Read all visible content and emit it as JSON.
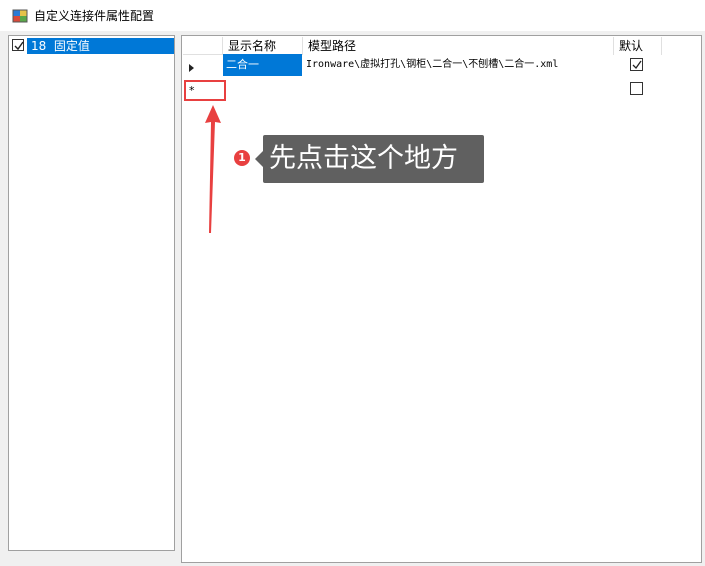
{
  "window": {
    "title": "自定义连接件属性配置"
  },
  "tree": {
    "items": [
      {
        "checked": true,
        "label": "18  固定值"
      }
    ]
  },
  "grid": {
    "columns": [
      {
        "label": "显示名称"
      },
      {
        "label": "模型路径"
      },
      {
        "label": "默认"
      }
    ],
    "rows": [
      {
        "name": "二合一",
        "path": "Ironware\\虚拟打孔\\钢柜\\二合一\\不刨槽\\二合一.xml",
        "default": true
      }
    ],
    "new_row_marker": "*"
  },
  "annotation": {
    "badge": "1",
    "tooltip": "先点击这个地方",
    "accent_color": "#e84040"
  }
}
